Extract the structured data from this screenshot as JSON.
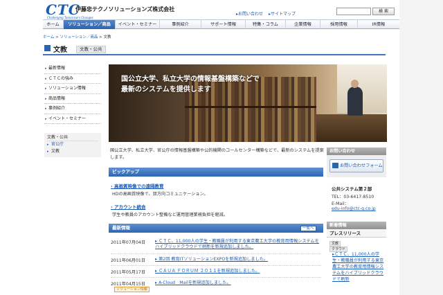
{
  "header": {
    "logo": "CTC",
    "tagline": "Challenging Tomorrow's Changes",
    "company": "伊藤忠テクノソリューションズ株式会社",
    "top_links": [
      "お問い合わせ",
      "サイトマップ"
    ],
    "search_button": "検 索"
  },
  "nav": {
    "items": [
      "ホーム",
      "ソリューション／商品",
      "イベント・セミナー",
      "事例紹介",
      "サポート情報",
      "特集・コラム",
      "企業情報",
      "採用情報",
      "IR情報"
    ],
    "active_index": 1
  },
  "breadcrumb": {
    "items": [
      "ホーム",
      "ソリューション／商品",
      "文教"
    ],
    "separator": ">"
  },
  "page": {
    "title": "文教",
    "tag": "文教・公共"
  },
  "sidebar": {
    "items": [
      "最新情報",
      "ＣＴＣの強み",
      "ソリューション情報",
      "商品情報",
      "事例紹介",
      "イベント・セミナー"
    ],
    "sub_title": "文教・公共",
    "sub_items": [
      "官公庁",
      "文教"
    ]
  },
  "hero": {
    "line1": "国公立大学、私立大学の情報基盤構築などで",
    "line2": "最新のシステムを提供します"
  },
  "intro": {
    "text": "国公立大学、私立大学、官公庁の情報基盤構築や公的機関のコールセンター構築などで、最新のシステムを提案します。"
  },
  "pickup": {
    "heading": "ピックアップ",
    "items": [
      {
        "title": "高画質映像での遠隔教育",
        "desc": "HDの高画質映像で、双方向コミュニケーション。"
      },
      {
        "title": "アカウント統合",
        "desc": "学生や教員のアカウント整備など運用管理業務負担を軽減。"
      }
    ]
  },
  "news": {
    "heading": "最新情報",
    "more": "一覧へ",
    "items": [
      {
        "date": "2011年07月04日",
        "text": "ＣＴＣ、11,000人の学生・教職員が利用する東京農工大学の教育用情報システムをハイブリッドクラウドで刷新を新規追加しました。"
      },
      {
        "date": "2011年06月01日",
        "text": "第2回 教育ITソリューションEXPOを新規追加しました。"
      },
      {
        "date": "2011年05月17日",
        "text": "ＣＡＵＡ ＦＯＲＵＭ ２０１１を新規追加しました。"
      },
      {
        "date": "2011年04月15日",
        "text": "A-Cloud　Mailを新規追加しました。",
        "tag": "ソリューション情報"
      }
    ]
  },
  "right": {
    "contact_heading": "お問い合わせ",
    "contact_button": "お問い合わせフォーム",
    "dept": "公共システム第２部",
    "tel": "TEL：03-6417-8510",
    "email_label": "E-Mail：",
    "email": "edu-info@ctc-g.co.jp",
    "news_heading": "新着情報",
    "press_heading": "プレスリリース",
    "press_tags": [
      "文教",
      "クラウド"
    ],
    "press_link": "ＣＴＣ、11,000人の学生・教職員が利用する東京農工大学の教育用情報システムをハイブリッドクラウドで刷新"
  },
  "colors": {
    "brand_blue": "#1a5bb3",
    "nav_active": "#2c63ad",
    "section_bar": "#3f74bd",
    "tag_orange": "#e4a23a"
  }
}
